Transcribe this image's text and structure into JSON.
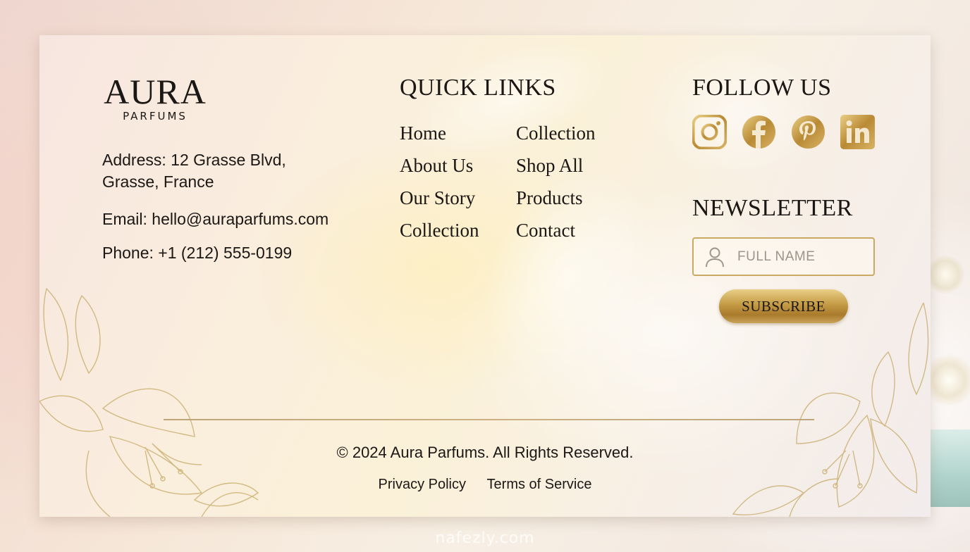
{
  "brand": {
    "logo_main": "AURA",
    "logo_sub": "PARFUMS"
  },
  "contact": {
    "address": "Address: 12 Grasse Blvd, Grasse, France",
    "email": "Email: hello@auraparfums.com",
    "phone": "Phone: +1 (212) 555-0199"
  },
  "quick_links": {
    "heading": "QUICK LINKS",
    "col1": [
      "Home",
      "About Us",
      "Our Story",
      "Collection"
    ],
    "col2": [
      "Collection",
      "Shop All",
      "Products",
      "Contact"
    ]
  },
  "follow": {
    "heading": "FOLLOW US",
    "icons": [
      "instagram-icon",
      "facebook-icon",
      "pinterest-icon",
      "linkedin-icon"
    ]
  },
  "newsletter": {
    "heading": "NEWSLETTER",
    "placeholder": "FULL NAME",
    "button": "SUBSCRIBE"
  },
  "footer": {
    "copyright": "© 2024 Aura Parfums. All Rights Reserved.",
    "privacy": "Privacy Policy",
    "terms": "Terms of Service"
  },
  "watermark": "nafezly.com",
  "colors": {
    "gold": "#c49a45",
    "text": "#1b1714"
  }
}
